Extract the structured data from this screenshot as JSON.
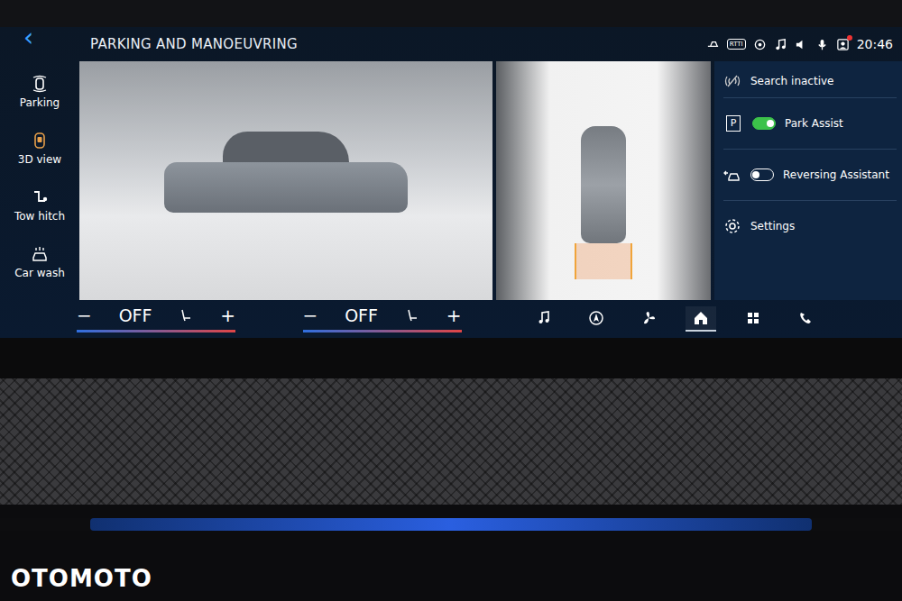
{
  "header": {
    "back": "‹",
    "title": "PARKING AND MANOEUVRING",
    "rtti": "RTTI",
    "time": "20:46",
    "notification": true
  },
  "sidebar": {
    "items": [
      {
        "label": "Parking",
        "selected": false
      },
      {
        "label": "3D view",
        "selected": true
      },
      {
        "label": "Tow hitch",
        "selected": false
      },
      {
        "label": "Car wash",
        "selected": false
      }
    ]
  },
  "panel": {
    "search": "Search inactive",
    "toggles": [
      {
        "badge": "P",
        "label": "Park Assist",
        "on": true
      },
      {
        "badge": "",
        "label": "Reversing Assistant",
        "on": false
      }
    ],
    "settings": "Settings"
  },
  "climate": [
    {
      "minus": "−",
      "value": "OFF",
      "plus": "+"
    },
    {
      "minus": "−",
      "value": "OFF",
      "plus": "+"
    }
  ],
  "nav": [
    {
      "selected": false
    },
    {
      "selected": false
    },
    {
      "selected": false
    },
    {
      "selected": true
    },
    {
      "selected": false
    },
    {
      "selected": false
    }
  ],
  "watermark": "OTOMOTO"
}
